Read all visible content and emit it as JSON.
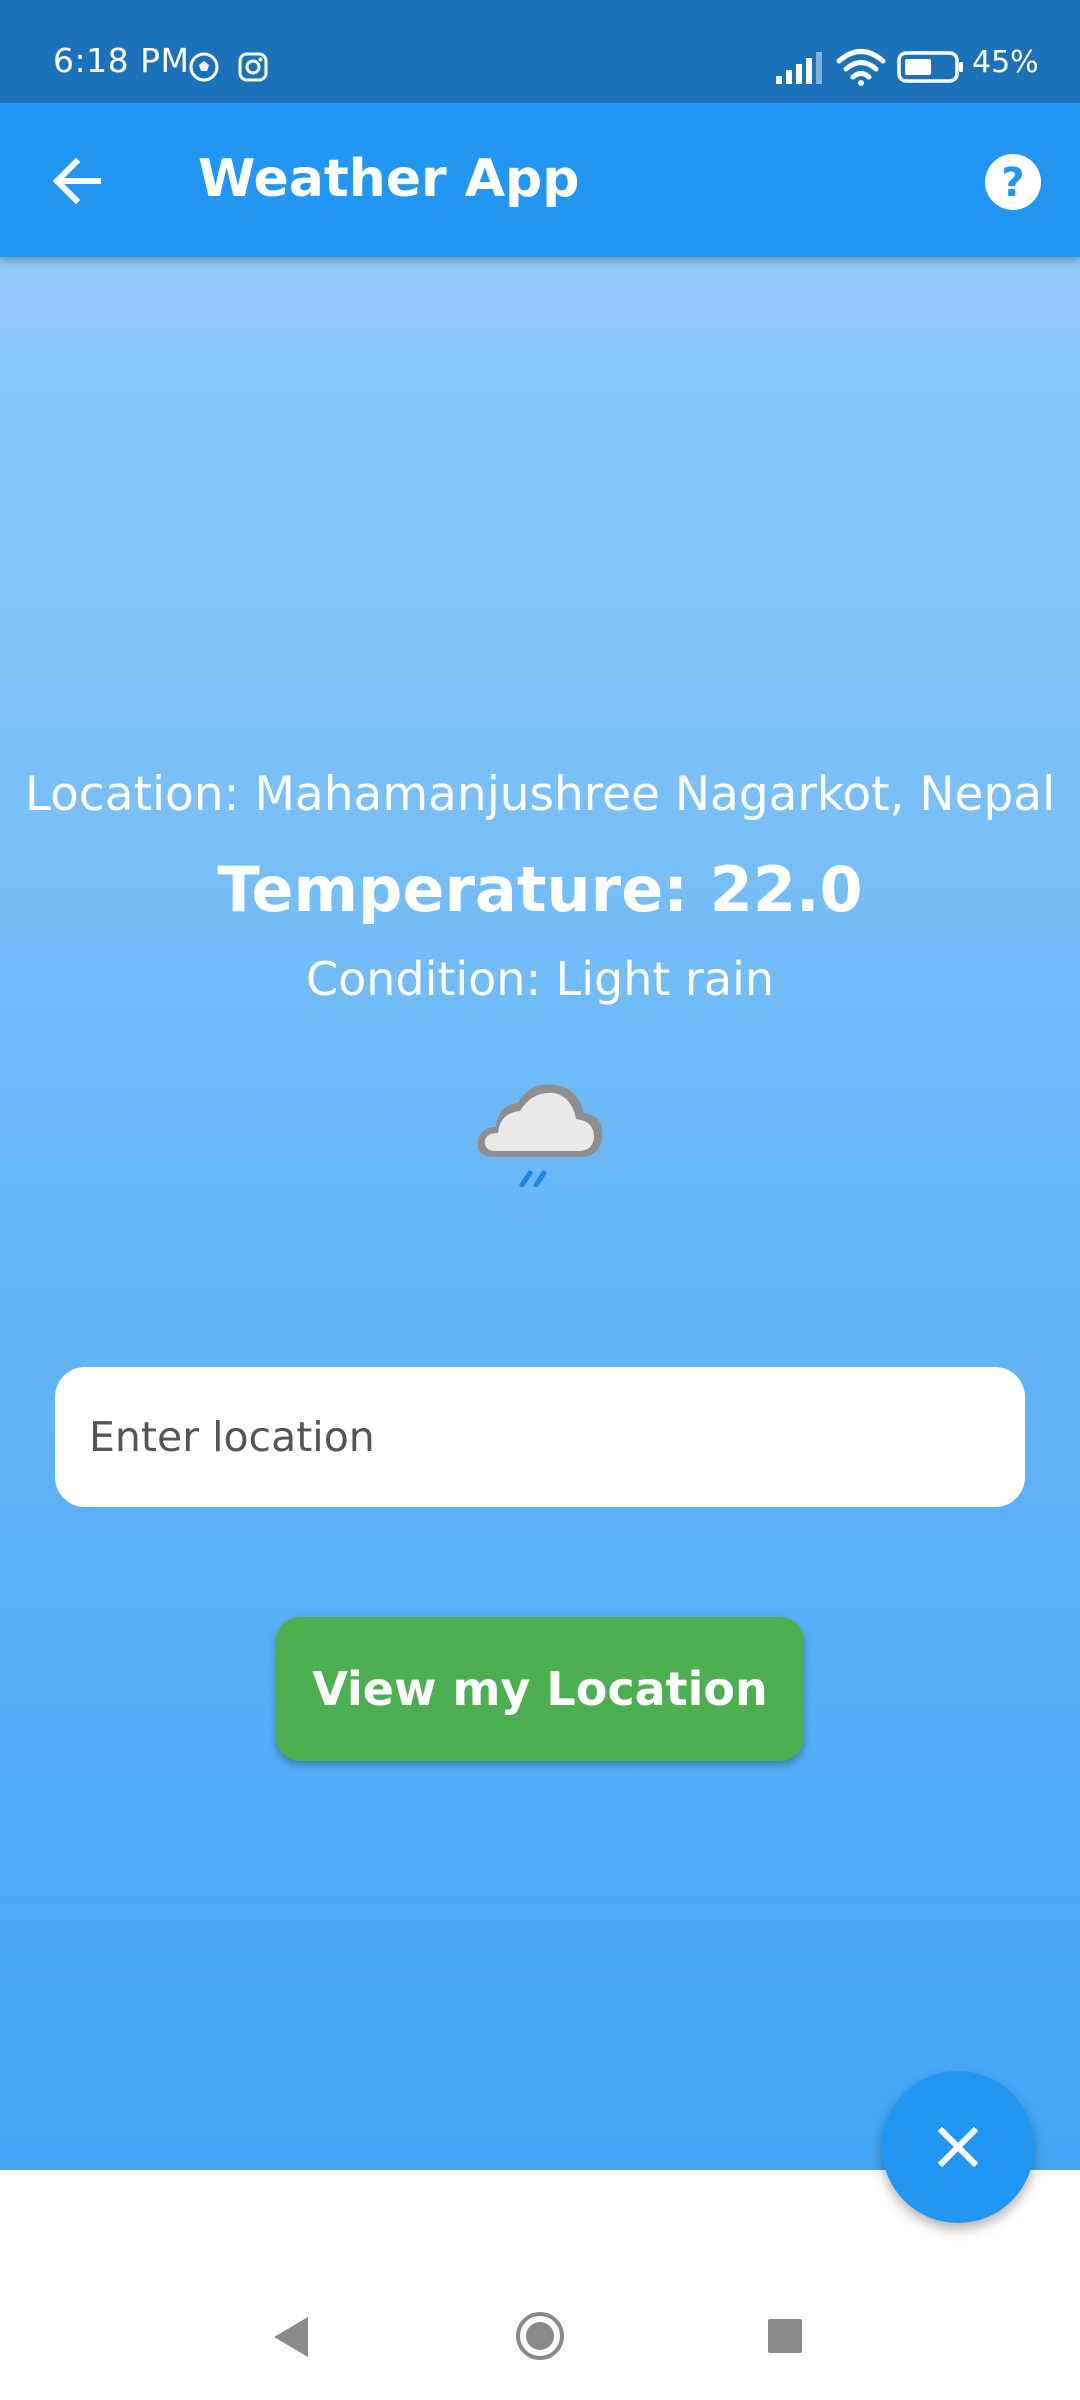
{
  "status_bar": {
    "time": "6:18 PM",
    "battery_percent": "45%",
    "icons": [
      "soccer-ball-icon",
      "instagram-icon",
      "signal-icon",
      "wifi-icon",
      "battery-icon"
    ]
  },
  "app_bar": {
    "title": "Weather App",
    "back_icon": "arrow-left-icon",
    "help_icon": "help-circle-icon"
  },
  "weather": {
    "location": "Location: Mahamanjushree Nagarkot, Nepal",
    "temperature": "Temperature: 22.0",
    "condition": "Condition: Light rain",
    "icon": "light-rain-cloud-icon"
  },
  "search": {
    "placeholder": "Enter location",
    "value": ""
  },
  "actions": {
    "view_location_label": "View my Location",
    "fab_icon": "close-icon"
  },
  "colors": {
    "status_bar": "#1c71bb",
    "app_bar": "#2196f3",
    "gradient_top": "#90caf9",
    "gradient_bottom": "#42a5f5",
    "button_green": "#4caf50",
    "fab": "#2196f3"
  },
  "nav_bar": {
    "buttons": [
      "back-triangle-icon",
      "home-circle-icon",
      "recents-square-icon"
    ]
  }
}
